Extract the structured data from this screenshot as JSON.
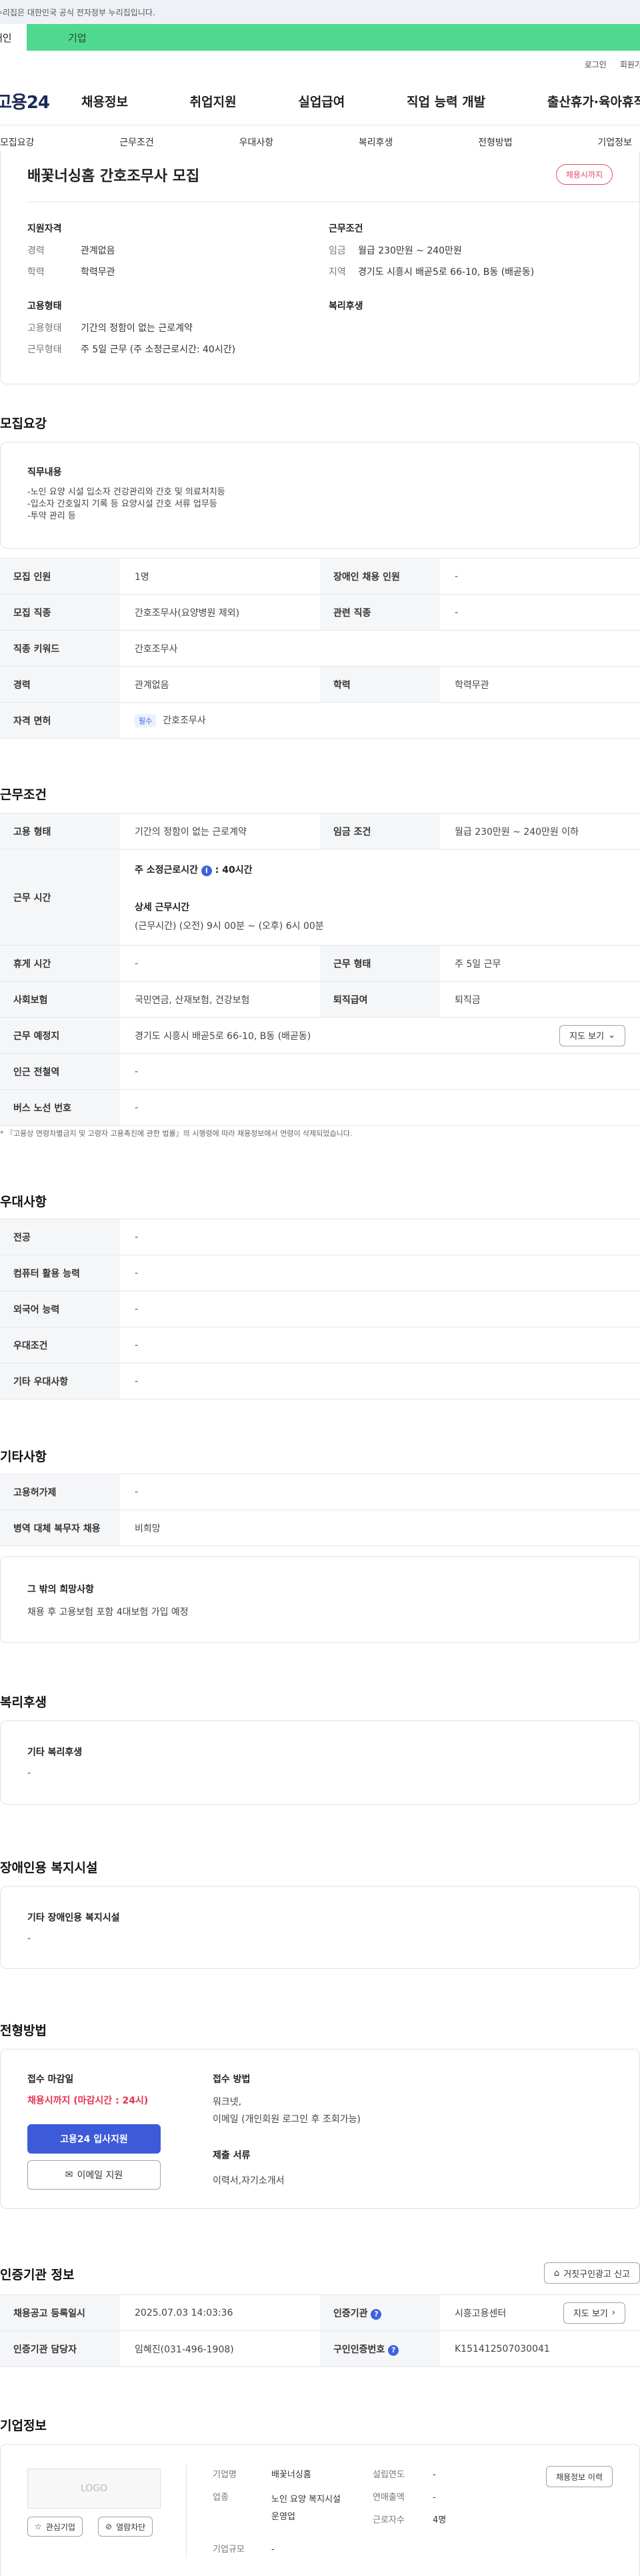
{
  "gov_banner": "이 누리집은 대한민국 공식 전자정부 누리집입니다.",
  "top_tabs": [
    "개인",
    "기업"
  ],
  "util_links": [
    "로그인",
    "회원가입"
  ],
  "logo": "고용24",
  "gnb": [
    "채용정보",
    "취업지원",
    "실업급여",
    "직업 능력 개발",
    "출산휴가·육아휴직"
  ],
  "snb": [
    "모집요강",
    "근무조건",
    "우대사항",
    "복리후생",
    "전형방법",
    "기업정보"
  ],
  "summary": {
    "title": "배꽃너싱홈 간호조무사 모집",
    "deadline_badge": "채용시까지",
    "left_heading": "지원자격",
    "career_k": "경력",
    "career_v": "관계없음",
    "edu_k": "학력",
    "edu_v": "학력무관",
    "emp_heading": "고용형태",
    "emp_k": "고용형태",
    "emp_v": "기간의 정함이 없는 근로계약",
    "shape_k": "근무형태",
    "shape_v": "주 5일 근무 (주 소정근로시간: 40시간)",
    "right_heading": "근무조건",
    "wage_k": "임금",
    "wage_v": "월급 230만원 ~ 240만원",
    "area_k": "지역",
    "area_v": "경기도 시흥시 배곧5로 66-10, B동 (배곧동)",
    "welfare_heading": "복리후생"
  },
  "recruit": {
    "title": "모집요강",
    "duty_heading": "직무내용",
    "duty_lines": [
      "-노인 요양 시설 입소자 건강관리와  간호 및 의료처치등",
      "-입소자 간호일지 기록 등 요양시설 간호 서류 업무등",
      "-투약 관리 등"
    ],
    "rows": {
      "count_k": "모집 인원",
      "count_v": "1명",
      "disabled_k": "장애인 채용 인원",
      "disabled_v": "-",
      "job_k": "모집 직종",
      "job_v": "간호조무사(요양병원 제외)",
      "related_k": "관련 직종",
      "related_v": "-",
      "keyword_k": "직종 키워드",
      "keyword_v": "간호조무사",
      "career_k": "경력",
      "career_v": "관계없음",
      "edu_k": "학력",
      "edu_v": "학력무관",
      "license_k": "자격 면허",
      "license_badge": "필수",
      "license_v": "간호조무사"
    }
  },
  "conditions": {
    "title": "근무조건",
    "emp_k": "고용 형태",
    "emp_v": "기간의 정함이 없는 근로계약",
    "wage_k": "임금 조건",
    "wage_v": "월급 230만원 ~ 240만원 이하",
    "hours_k": "근무 시간",
    "hours_main": "주 소정근로시간",
    "hours_main_v": ": 40시간",
    "hours_detail_h": "상세 근무시간",
    "hours_detail_v": "(근무시간) (오전) 9시 00분 ~ (오후) 6시 00분",
    "rest_k": "휴게 시간",
    "rest_v": "-",
    "shape_k": "근무 형태",
    "shape_v": "주 5일 근무",
    "insurance_k": "사회보험",
    "insurance_v": "국민연금, 산재보험, 건강보험",
    "severance_k": "퇴직급여",
    "severance_v": "퇴직금",
    "place_k": "근무 예정지",
    "place_v": "경기도 시흥시 배곧5로 66-10, B동 (배곧동)",
    "map_btn": "지도 보기",
    "subway_k": "인근 전철역",
    "subway_v": "-",
    "bus_k": "버스 노선 번호",
    "bus_v": "-",
    "note": "* 『고용상 연령차별금지 및 고령자 고용촉진에 관한 법률』의 시행령에 따라 채용정보에서 연령이 삭제되었습니다."
  },
  "prefer": {
    "title": "우대사항",
    "rows": [
      {
        "k": "전공",
        "v": "-"
      },
      {
        "k": "컴퓨터 활용 능력",
        "v": "-"
      },
      {
        "k": "외국어 능력",
        "v": "-"
      },
      {
        "k": "우대조건",
        "v": "-"
      },
      {
        "k": "기타 우대사항",
        "v": "-"
      }
    ]
  },
  "etc": {
    "title": "기타사항",
    "r1_k": "고용허가제",
    "r1_v": "-",
    "r2_k": "병역 대체 복무자 채용",
    "r2_v": "비희망",
    "wish_h": "그 밖의 희망사항",
    "wish_v": "채용 후 고용보험 포함 4대보험 가입 예정"
  },
  "welfare": {
    "title": "복리후생",
    "h": "기타 복리후생",
    "v": "-"
  },
  "disabled": {
    "title": "장애인용 복지시설",
    "h": "기타 장애인용 복지시설",
    "v": "-"
  },
  "process": {
    "title": "전형방법",
    "deadline_h": "접수 마감일",
    "deadline_v": "채용시까지 (마감시간 : 24시)",
    "apply_btn": "고용24 입사지원",
    "email_btn": "이메일 지원",
    "method_h": "접수 방법",
    "method_v1": "워크넷,",
    "method_v2": "이메일 (개인회원 로그인 후 조회가능)",
    "docs_h": "제출 서류",
    "docs_v": "이력서,자기소개서"
  },
  "agency": {
    "title": "인증기관 정보",
    "report_btn": "거짓구인광고 신고",
    "reg_k": "채용공고 등록일시",
    "reg_v": "2025.07.03 14:03:36",
    "org_k": "인증기관",
    "org_v": "시흥고용센터",
    "map_btn": "지도 보기",
    "manager_k": "인증기관 담당자",
    "manager_v": "임혜진(031-496-1908)",
    "cert_k": "구인인증번호",
    "cert_v": "K151412507030041"
  },
  "company": {
    "title": "기업정보",
    "logo_text": "LOGO",
    "interest_btn": "관심기업",
    "block_btn": "열람차단",
    "name_k": "기업명",
    "name_v": "배꽃너싱홈",
    "industry_k": "업종",
    "industry_v": "노인 요양 복지시설 운영업",
    "size_k": "기업규모",
    "size_v": "-",
    "founded_k": "설립연도",
    "founded_v": "-",
    "sales_k": "연매출액",
    "sales_v": "-",
    "staff_k": "근로자수",
    "staff_v": "4명",
    "history_btn": "채용정보 이력"
  }
}
